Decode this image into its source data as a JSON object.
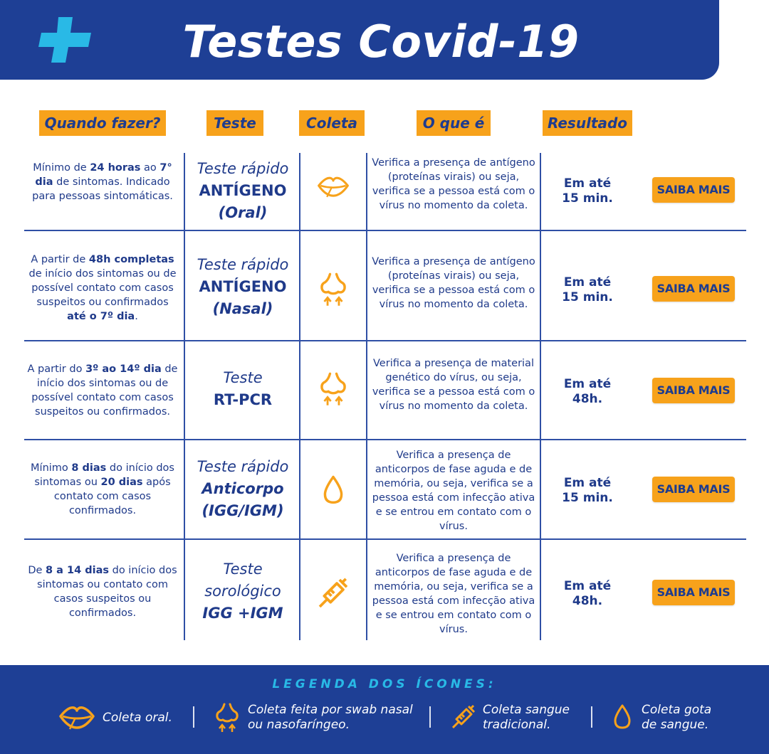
{
  "header": {
    "title": "Testes Covid-19",
    "accent_color": "#1e3f95",
    "logo_icon": "plus-cross-icon"
  },
  "columns": {
    "when": "Quando fazer?",
    "test": "Teste",
    "collection": "Coleta",
    "what": "O que é",
    "result": "Resultado"
  },
  "rows": [
    {
      "when": [
        {
          "t": "Mínimo de ",
          "b": false
        },
        {
          "t": "24 horas",
          "b": true
        },
        {
          "t": " ao ",
          "b": false
        },
        {
          "t": "7° dia",
          "b": true
        },
        {
          "t": " de sintomas. Indicado para pessoas sintomáticas.",
          "b": false
        }
      ],
      "test": [
        {
          "t": "Teste rápido",
          "s": "lite"
        },
        {
          "t": "ANTÍGENO",
          "s": "bold"
        },
        {
          "t": "(Oral)",
          "s": "boldit"
        }
      ],
      "icon": "lips-icon",
      "what": "Verifica a presença de antígeno (proteínas virais) ou seja, verifica se a pessoa está com o vírus no momento da coleta.",
      "result": [
        "Em até",
        "15 min."
      ],
      "button": "SAIBA MAIS"
    },
    {
      "when": [
        {
          "t": "A partir de ",
          "b": false
        },
        {
          "t": "48h completas",
          "b": true
        },
        {
          "t": " de início dos sintomas ou de possível contato com casos suspeitos ou confirmados ",
          "b": false
        },
        {
          "t": "até o 7º dia",
          "b": true
        },
        {
          "t": ".",
          "b": false
        }
      ],
      "test": [
        {
          "t": "Teste rápido",
          "s": "lite"
        },
        {
          "t": "ANTÍGENO",
          "s": "bold"
        },
        {
          "t": "(Nasal)",
          "s": "boldit"
        }
      ],
      "icon": "nose-swab-icon",
      "what": "Verifica a presença de antígeno (proteínas virais) ou seja, verifica se a pessoa está com o vírus no momento da coleta.",
      "result": [
        "Em até",
        "15 min."
      ],
      "button": "SAIBA MAIS"
    },
    {
      "when": [
        {
          "t": "A partir do ",
          "b": false
        },
        {
          "t": "3º ao 14º dia",
          "b": true
        },
        {
          "t": " de início dos sintomas ou de possível contato com casos suspeitos ou confirmados.",
          "b": false
        }
      ],
      "test": [
        {
          "t": "Teste",
          "s": "lite"
        },
        {
          "t": "RT-PCR",
          "s": "bold"
        }
      ],
      "icon": "nose-swab-icon",
      "what": "Verifica a presença de material genético do vírus, ou seja, verifica se a pessoa está com o vírus no momento da coleta.",
      "result": [
        "Em até",
        "48h."
      ],
      "button": "SAIBA MAIS"
    },
    {
      "when": [
        {
          "t": "Mínimo ",
          "b": false
        },
        {
          "t": "8 dias",
          "b": true
        },
        {
          "t": " do início dos sintomas ou ",
          "b": false
        },
        {
          "t": "20 dias",
          "b": true
        },
        {
          "t": " após contato com casos confirmados.",
          "b": false
        }
      ],
      "test": [
        {
          "t": "Teste rápido",
          "s": "lite"
        },
        {
          "t": "Anticorpo",
          "s": "boldit"
        },
        {
          "t": "(IGG/IGM)",
          "s": "boldit"
        }
      ],
      "icon": "blood-drop-icon",
      "what": "Verifica a presença de anticorpos de fase aguda e de memória, ou seja, verifica se a pessoa está com infecção ativa e se entrou em contato com o vírus.",
      "result": [
        "Em até",
        "15 min."
      ],
      "button": "SAIBA MAIS"
    },
    {
      "when": [
        {
          "t": "De ",
          "b": false
        },
        {
          "t": "8 a 14 dias",
          "b": true
        },
        {
          "t": " do início dos sintomas ou contato com casos suspeitos ou confirmados.",
          "b": false
        }
      ],
      "test": [
        {
          "t": "Teste",
          "s": "lite"
        },
        {
          "t": "sorológico",
          "s": "lite"
        },
        {
          "t": "IGG +IGM",
          "s": "boldit"
        }
      ],
      "icon": "syringe-icon",
      "what": "Verifica a presença de anticorpos de fase aguda e de memória, ou seja, verifica se a pessoa está com infecção ativa e se entrou em contato com o vírus.",
      "result": [
        "Em até",
        "48h."
      ],
      "button": "SAIBA MAIS"
    }
  ],
  "legend": {
    "title": "LEGENDA DOS ÍCONES:",
    "items": [
      {
        "icon": "lips-icon",
        "label": "Coleta oral."
      },
      {
        "icon": "nose-swab-icon",
        "label": "Coleta feita por swab nasal ou nasofaríngeo."
      },
      {
        "icon": "syringe-icon",
        "label": "Coleta sangue tradicional."
      },
      {
        "icon": "blood-drop-icon",
        "label": "Coleta gota de sangue."
      }
    ]
  },
  "colors": {
    "navy": "#1e3f95",
    "orange": "#f7a21b",
    "cyan": "#29b9e6",
    "text": "#1f3a8a"
  }
}
